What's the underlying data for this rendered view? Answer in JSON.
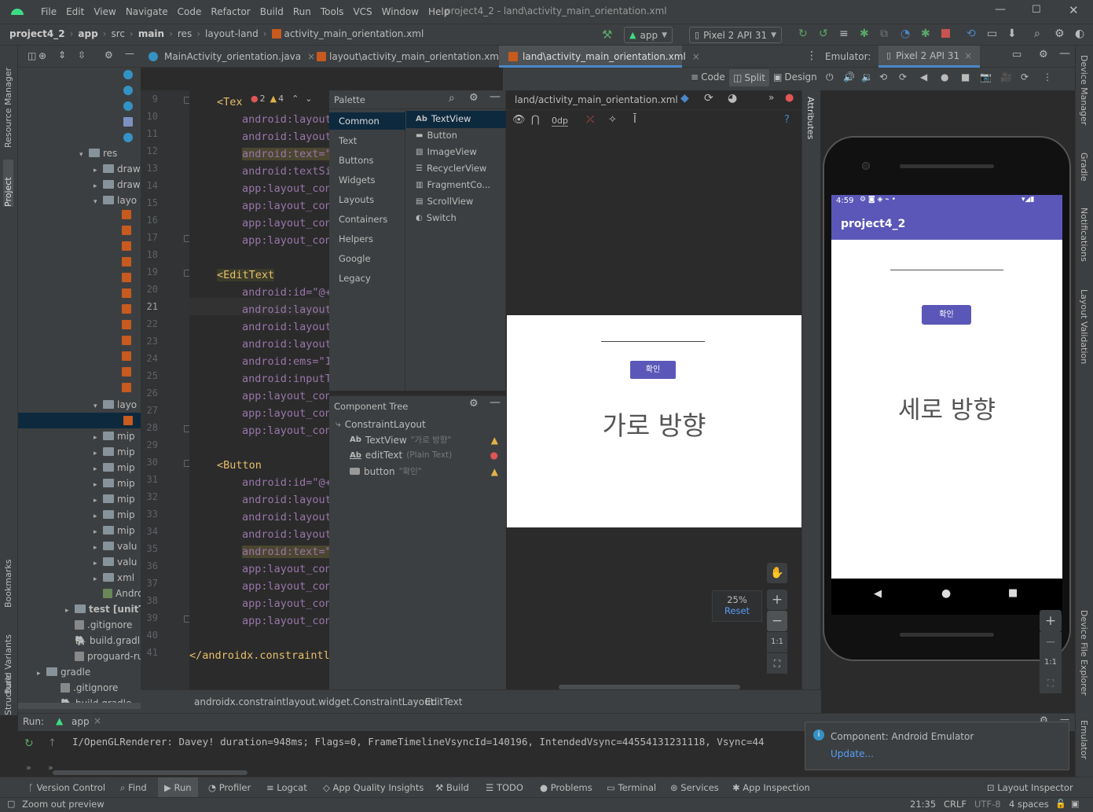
{
  "window": {
    "title": "project4_2 - land\\activity_main_orientation.xml",
    "menu": [
      "File",
      "Edit",
      "View",
      "Navigate",
      "Code",
      "Refactor",
      "Build",
      "Run",
      "Tools",
      "VCS",
      "Window",
      "Help"
    ]
  },
  "breadcrumb": [
    "project4_2",
    "app",
    "src",
    "main",
    "res",
    "layout-land",
    "activity_main_orientation.xml"
  ],
  "toolbar": {
    "run_config": "app",
    "device": "Pixel 2 API 31"
  },
  "tabs": [
    {
      "label": "MainActivity_orientation.java"
    },
    {
      "label": "layout\\activity_main_orientation.xml"
    },
    {
      "label": "land\\activity_main_orientation.xml",
      "active": true
    }
  ],
  "view_modes": {
    "code": "Code",
    "split": "Split",
    "design": "Design"
  },
  "project_tree": {
    "res": "res",
    "drawable1": "draw",
    "drawable2": "draw",
    "layout1": "layo",
    "layout2": "layo",
    "mipmap": [
      "mip",
      "mip",
      "mip",
      "mip",
      "mip",
      "mip",
      "mip"
    ],
    "values1": "valu",
    "values2": "valu",
    "xml": "xml",
    "manifest": "Androi",
    "test": "test [unitTe",
    "gitignore1": ".gitignore",
    "build_gradle1": "build.gradle",
    "proguard": "proguard-rules",
    "gradle": "gradle",
    "gitignore2": ".gitignore",
    "build_gradle2": "build.gradle"
  },
  "editor": {
    "line_numbers": [
      "9",
      "10",
      "11",
      "12",
      "13",
      "14",
      "15",
      "16",
      "17",
      "18",
      "19",
      "20",
      "21",
      "22",
      "23",
      "24",
      "25",
      "26",
      "27",
      "28",
      "29",
      "30",
      "31",
      "32",
      "33",
      "34",
      "35",
      "36",
      "37",
      "38",
      "39",
      "40",
      "41"
    ],
    "warnings": {
      "errors": "2",
      "warns": "4"
    },
    "lines": [
      {
        "n": "9",
        "tag": "<Tex",
        "attr": "",
        "rest": ""
      },
      {
        "n": "10",
        "attr": "android:layout",
        "rest": ""
      },
      {
        "n": "11",
        "attr": "android:layout",
        "rest": ""
      },
      {
        "n": "12",
        "attr": "android:text=\"",
        "rest": ""
      },
      {
        "n": "13",
        "attr": "android:textSi",
        "rest": ""
      },
      {
        "n": "14",
        "attr": "app:layout_con",
        "rest": ""
      },
      {
        "n": "15",
        "attr": "app:layout_con",
        "rest": ""
      },
      {
        "n": "16",
        "attr": "app:layout_con",
        "rest": ""
      },
      {
        "n": "17",
        "attr": "app:layout_con",
        "rest": ""
      },
      {
        "n": "19",
        "tag": "<EditText"
      },
      {
        "n": "20",
        "attr": "android:id=\"@+"
      },
      {
        "n": "21",
        "attr": "android:layout"
      },
      {
        "n": "22",
        "attr": "android:layout"
      },
      {
        "n": "23",
        "attr": "android:layout"
      },
      {
        "n": "24",
        "attr": "android:ems=\"1"
      },
      {
        "n": "25",
        "attr": "android:inputT"
      },
      {
        "n": "26",
        "attr": "app:layout_con"
      },
      {
        "n": "27",
        "attr": "app:layout_con"
      },
      {
        "n": "28",
        "attr": "app:layout_con"
      },
      {
        "n": "30",
        "tag": "<Button"
      },
      {
        "n": "31",
        "attr": "android:id=\"@+"
      },
      {
        "n": "32",
        "attr": "android:layout"
      },
      {
        "n": "33",
        "attr": "android:layout"
      },
      {
        "n": "34",
        "attr": "android:layout"
      },
      {
        "n": "35",
        "attr": "android:text=\""
      },
      {
        "n": "36",
        "attr": "app:layout_con"
      },
      {
        "n": "37",
        "attr": "app:layout_con"
      },
      {
        "n": "38",
        "attr": "app:layout_con"
      },
      {
        "n": "39",
        "attr": "app:layout_con"
      },
      {
        "n": "41",
        "tag": "</androidx.constraintl"
      }
    ]
  },
  "palette": {
    "title": "Palette",
    "categories": [
      "Common",
      "Text",
      "Buttons",
      "Widgets",
      "Layouts",
      "Containers",
      "Helpers",
      "Google",
      "Legacy"
    ],
    "items": [
      {
        "prefix": "Ab",
        "label": "TextView"
      },
      {
        "label": "Button"
      },
      {
        "label": "ImageView"
      },
      {
        "label": "RecyclerView"
      },
      {
        "label": "FragmentCo..."
      },
      {
        "label": "ScrollView"
      },
      {
        "label": "Switch"
      }
    ]
  },
  "component_tree": {
    "title": "Component Tree",
    "root": "ConstraintLayout",
    "children": [
      {
        "name": "TextView",
        "hint": "\"가로 방향\"",
        "status": "warn"
      },
      {
        "name": "editText",
        "hint": "(Plain Text)",
        "status": "error"
      },
      {
        "name": "button",
        "hint": "\"확인\"",
        "status": "warn"
      }
    ]
  },
  "design": {
    "file": "land/activity_main_orientation.xml",
    "margin": "0dp",
    "preview_button": "확인",
    "preview_text": "가로 방향",
    "zoom": "25%",
    "reset": "Reset",
    "ratio": "1:1"
  },
  "statusbar_path": [
    "androidx.constraintlayout.widget.ConstraintLayout",
    "EditText"
  ],
  "emulator": {
    "label": "Emulator:",
    "device": "Pixel 2 API 31",
    "time": "4:59",
    "app_title": "project4_2",
    "button": "확인",
    "text": "세로 방향",
    "ratio": "1:1",
    "accent": "#5b57b8"
  },
  "run": {
    "label": "Run:",
    "config": "app",
    "log": "I/OpenGLRenderer: Davey! duration=948ms; Flags=0, FrameTimelineVsyncId=140196, IntendedVsync=44554131231118, Vsync=44"
  },
  "notification": {
    "title": "Component: Android Emulator",
    "link": "Update..."
  },
  "bottom_tabs": [
    "Version Control",
    "Find",
    "Run",
    "Profiler",
    "Logcat",
    "App Quality Insights",
    "Build",
    "TODO",
    "Problems",
    "Terminal",
    "Services",
    "App Inspection"
  ],
  "layout_inspector": "Layout Inspector",
  "status": {
    "hint": "Zoom out preview",
    "position": "21:35",
    "line_sep": "CRLF",
    "encoding": "UTF-8",
    "indent": "4 spaces"
  },
  "left_tools": [
    "Resource Manager",
    "Project",
    "Bookmarks",
    "Build Variants",
    "Structure"
  ],
  "right_tools": [
    "Device Manager",
    "Gradle",
    "Notifications",
    "Layout Validation",
    "Device File Explorer",
    "Emulator"
  ],
  "attributes_label": "Attributes"
}
